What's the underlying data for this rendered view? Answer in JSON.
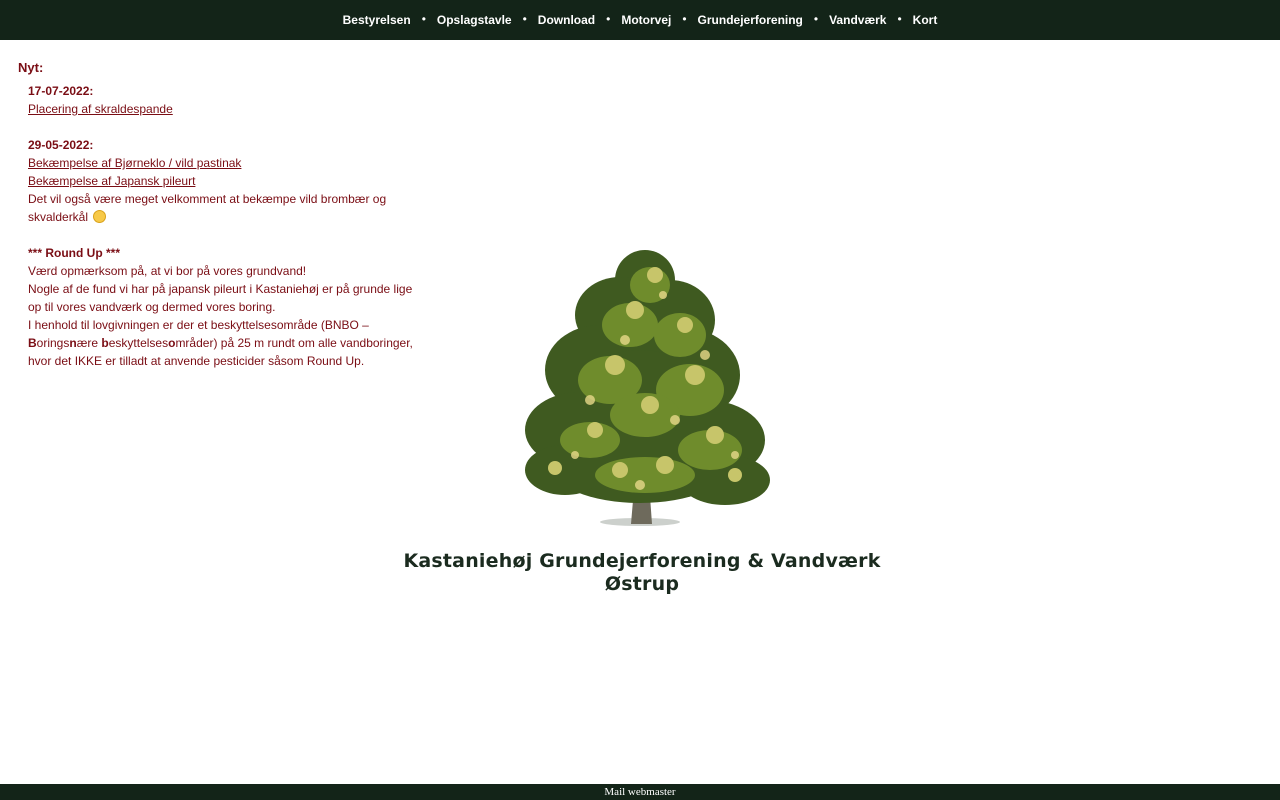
{
  "nav": {
    "items": [
      {
        "label": "Bestyrelsen"
      },
      {
        "label": "Opslagstavle"
      },
      {
        "label": "Download"
      },
      {
        "label": "Motorvej"
      },
      {
        "label": "Grundejerforening"
      },
      {
        "label": "Vandværk"
      },
      {
        "label": "Kort"
      }
    ],
    "separator": "•"
  },
  "news": {
    "heading": "Nyt:",
    "entry1": {
      "date": "17-07-2022:",
      "link": "Placering af skraldespande"
    },
    "entry2": {
      "date": "29-05-2022:",
      "link1": "Bekæmpelse af Bjørneklo / vild pastinak",
      "link2": "Bekæmpelse af Japansk pileurt",
      "text_line1": "Det vil også være meget velkomment at bekæmpe vild brombær og",
      "text_line2": "skvalderkål"
    },
    "entry3": {
      "title": "*** Round Up ***",
      "line1": "Værd opmærksom på, at vi bor på vores grundvand!",
      "line2": "Nogle af de fund vi har på japansk pileurt i Kastaniehøj er på grunde lige",
      "line3": "op til vores vandværk og dermed vores boring.",
      "line4": "I henhold til lovgivningen er der et beskyttelsesområde (BNBO –",
      "line5_b": "B",
      "line5_a": "orings",
      "line5_n": "n",
      "line5_c": "ære ",
      "line5_b2": "b",
      "line5_d": "eskyttelses",
      "line5_o": "o",
      "line5_e": "mråder) på 25 m rundt om alle vandboringer,",
      "line6": "hvor det IKKE er tilladt at anvende pesticider såsom Round Up."
    }
  },
  "site": {
    "title_line1": "Kastaniehøj Grundejerforening & Vandværk",
    "title_line2": "Østrup"
  },
  "footer": {
    "link": "Mail webmaster"
  },
  "colors": {
    "nav_bg": "#132418",
    "text_red": "#7a0d14",
    "title_green": "#1b2b1f",
    "emoji": "smiling-face-icon"
  }
}
